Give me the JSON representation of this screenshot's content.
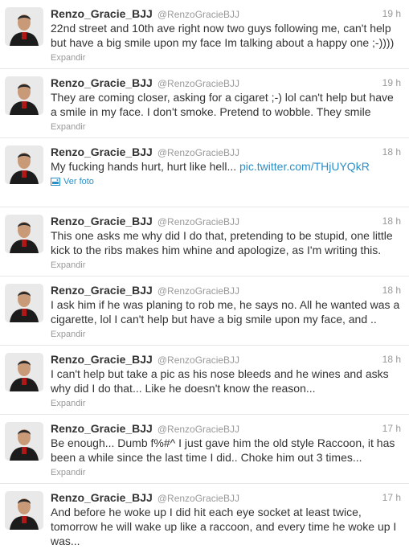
{
  "tweets": [
    {
      "fullname": "Renzo_Gracie_BJJ",
      "username": "@RenzoGracieBJJ",
      "time": "19 h",
      "text": "22nd street and 10th ave right now two guys following me, can't help but have a big smile upon my face Im talking about a happy one ;-))))",
      "action": "Expandir"
    },
    {
      "fullname": "Renzo_Gracie_BJJ",
      "username": "@RenzoGracieBJJ",
      "time": "19 h",
      "text": "They are coming closer, asking for a cigaret ;-) lol can't help but have a smile in my face. I don't smoke. Pretend to wobble. They smile",
      "action": "Expandir"
    },
    {
      "fullname": "Renzo_Gracie_BJJ",
      "username": "@RenzoGracieBJJ",
      "time": "18 h",
      "text": "My fucking hands hurt, hurt like hell...",
      "link": "pic.twitter.com/THjUYQkR",
      "action": "Ver foto"
    },
    {
      "fullname": "Renzo_Gracie_BJJ",
      "username": "@RenzoGracieBJJ",
      "time": "18 h",
      "text": "This one asks me why did I do that, pretending to be stupid, one little kick to the ribs makes him whine and apologize, as I'm writing this.",
      "action": "Expandir"
    },
    {
      "fullname": "Renzo_Gracie_BJJ",
      "username": "@RenzoGracieBJJ",
      "time": "18 h",
      "text": "I ask him if he was planing to rob me, he says no. All he wanted was a cigarette, lol I can't help but have a big smile upon my face, and ..",
      "action": "Expandir"
    },
    {
      "fullname": "Renzo_Gracie_BJJ",
      "username": "@RenzoGracieBJJ",
      "time": "18 h",
      "text": "I can't help but take a pic as his nose bleeds and he wines and asks why did I do that... Like he doesn't know the reason...",
      "action": "Expandir"
    },
    {
      "fullname": "Renzo_Gracie_BJJ",
      "username": "@RenzoGracieBJJ",
      "time": "17 h",
      "text": "Be enough... Dumb f%#^ I just gave him the old style Raccoon, it has been a while since the last time I did.. Choke him out 3 times...",
      "action": "Expandir"
    },
    {
      "fullname": "Renzo_Gracie_BJJ",
      "username": "@RenzoGracieBJJ",
      "time": "17 h",
      "text": "And before he woke up I did hit each eye socket at least twice, tomorrow he will wake up like a raccoon, and every time he woke up I was..."
    }
  ]
}
